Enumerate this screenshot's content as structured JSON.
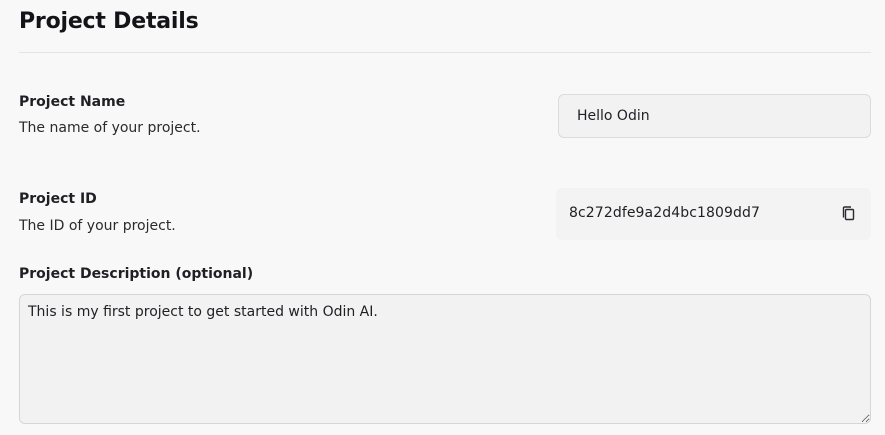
{
  "header": {
    "title": "Project Details"
  },
  "project_name": {
    "label": "Project Name",
    "description": "The name of your project.",
    "value": "Hello Odin"
  },
  "project_id": {
    "label": "Project ID",
    "description": "The ID of your project.",
    "value": "8c272dfe9a2d4bc1809dd7",
    "copy_icon": "copy-icon"
  },
  "project_description": {
    "label": "Project Description (optional)",
    "value": "This is my first project to get started with Odin AI."
  }
}
